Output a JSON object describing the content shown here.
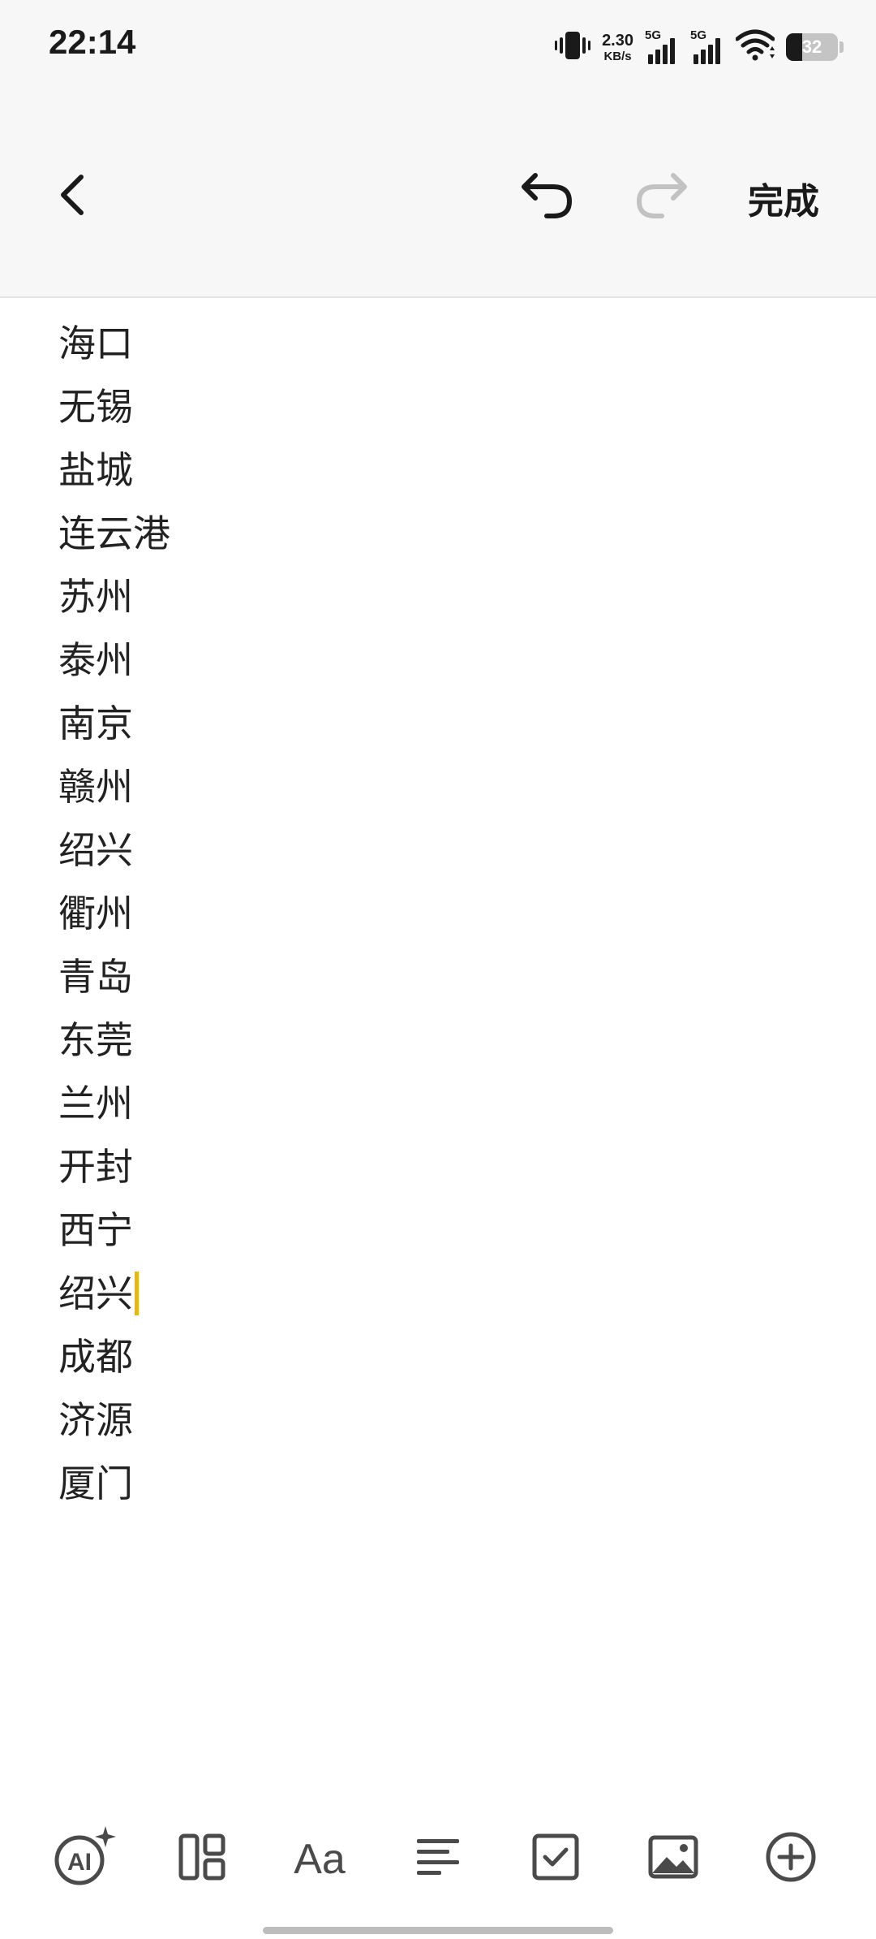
{
  "status_bar": {
    "time": "22:14",
    "net_speed_value": "2.30",
    "net_speed_unit": "KB/s",
    "sim1_label": "5G",
    "sim2_label": "5G",
    "battery_level": "32",
    "battery_fraction": 0.32
  },
  "toolbar": {
    "done_label": "完成"
  },
  "note": {
    "lines": [
      "海口",
      "无锡",
      "盐城",
      "连云港",
      "苏州",
      "泰州",
      "南京",
      "赣州",
      "绍兴",
      "衢州",
      "青岛",
      "东莞",
      "兰州",
      "开封",
      "西宁",
      "绍兴",
      "成都",
      "济源",
      "厦门"
    ],
    "caret_line_index": 15
  },
  "bottom_toolbar": {
    "ai_label": "AI",
    "font_label": "Aa"
  },
  "colors": {
    "caret": "#e8b51c",
    "toolbar_bg": "#f7f7f7",
    "icon": "#4a4a4a",
    "icon_disabled": "#c2c2c2"
  }
}
